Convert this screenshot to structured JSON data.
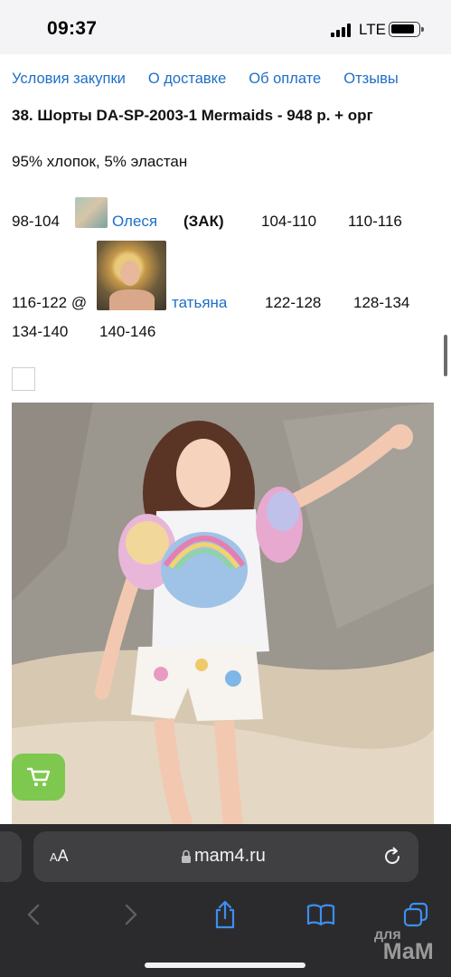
{
  "status_bar": {
    "time": "09:37",
    "network": "LTE",
    "battery_level": 0.8
  },
  "nav_links": [
    "Условия закупки",
    "О доставке",
    "Об оплате",
    "Отзывы"
  ],
  "product": {
    "title": "38. Шорты DA-SP-2003-1 Mermaids -  948 р. + орг",
    "composition": "95% хлопок, 5% эластан"
  },
  "sizes": {
    "row1": {
      "size": "98-104",
      "user": "Олеся",
      "status": "(ЗАК)",
      "size2": "104-110",
      "size3": "110-116"
    },
    "row2": {
      "size": "116-122 @",
      "user": "татьяна",
      "size2": "122-128",
      "size3": "128-134"
    },
    "row3": {
      "size1": "134-140",
      "size2": "140-146"
    }
  },
  "browser": {
    "aa_small": "A",
    "aa_large": "A",
    "url": "mam4.ru"
  },
  "watermark": {
    "line1": "для",
    "line2": "МаМ"
  },
  "icons": {
    "cart": "shopping-cart-icon",
    "back": "chevron-left-icon",
    "forward": "chevron-right-icon",
    "share": "share-icon",
    "bookmarks": "book-icon",
    "tabs": "tabs-icon",
    "lock": "lock-icon",
    "reload": "reload-icon"
  },
  "colors": {
    "link": "#1f6fc5",
    "cart_button": "#7ec850",
    "toolbar": "#2b2b2d"
  }
}
